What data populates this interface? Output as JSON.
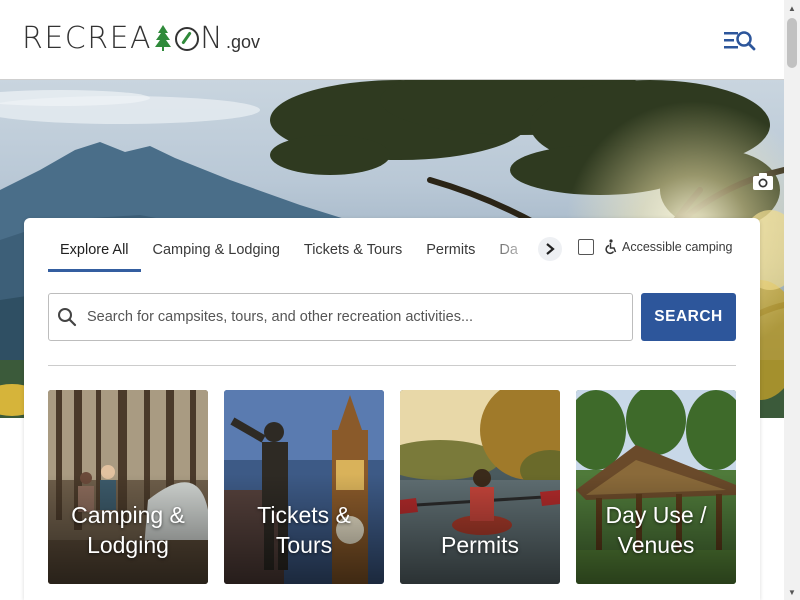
{
  "logo": {
    "text_before": "RECRE",
    "text_middle": "A",
    "text_end": "N",
    "suffix": ".gov",
    "tree_icon": "pine-tree-icon",
    "compass_icon": "compass-icon",
    "brand_color": "#2f8a3a"
  },
  "header": {
    "menu_icon": "menu-search-icon"
  },
  "hero": {
    "camera_icon": "camera-icon"
  },
  "search_panel": {
    "tabs": [
      {
        "label": "Explore All",
        "active": true
      },
      {
        "label": "Camping & Lodging"
      },
      {
        "label": "Tickets & Tours"
      },
      {
        "label": "Permits"
      },
      {
        "label": "Da"
      }
    ],
    "next_tab_icon": "chevron-right-icon",
    "accessible_label": "Accessible camping",
    "accessible_checked": false,
    "search_placeholder": "Search for campsites, tours, and other recreation activities...",
    "search_button": "SEARCH",
    "accent_color": "#2d569b"
  },
  "tiles": [
    {
      "label_line1": "Camping &",
      "label_line2": "Lodging"
    },
    {
      "label_line1": "Tickets &",
      "label_line2": "Tours"
    },
    {
      "label_line1": "",
      "label_line2": "Permits"
    },
    {
      "label_line1": "Day Use /",
      "label_line2": "Venues"
    }
  ]
}
